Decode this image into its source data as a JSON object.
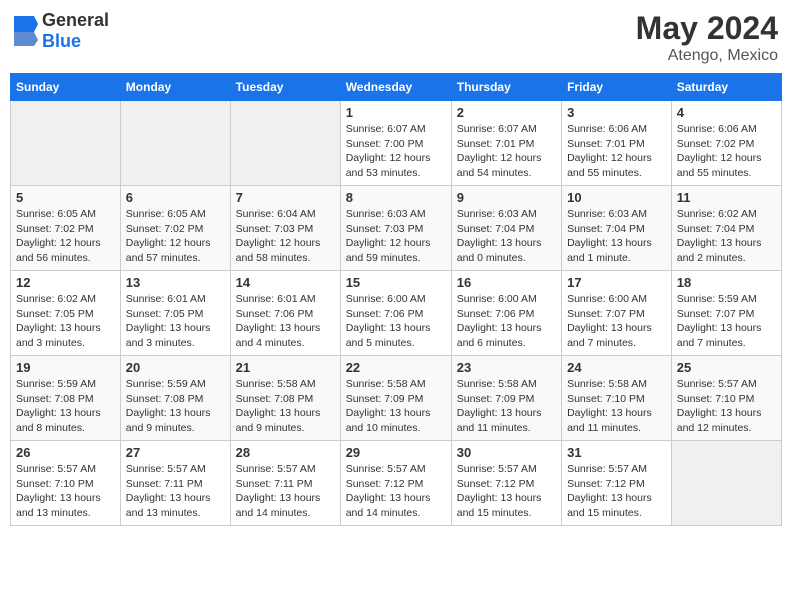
{
  "header": {
    "logo": {
      "general": "General",
      "blue": "Blue"
    },
    "title": "May 2024",
    "location": "Atengo, Mexico"
  },
  "calendar": {
    "days_of_week": [
      "Sunday",
      "Monday",
      "Tuesday",
      "Wednesday",
      "Thursday",
      "Friday",
      "Saturday"
    ],
    "weeks": [
      [
        {
          "day": "",
          "info": ""
        },
        {
          "day": "",
          "info": ""
        },
        {
          "day": "",
          "info": ""
        },
        {
          "day": "1",
          "info": "Sunrise: 6:07 AM\nSunset: 7:00 PM\nDaylight: 12 hours\nand 53 minutes."
        },
        {
          "day": "2",
          "info": "Sunrise: 6:07 AM\nSunset: 7:01 PM\nDaylight: 12 hours\nand 54 minutes."
        },
        {
          "day": "3",
          "info": "Sunrise: 6:06 AM\nSunset: 7:01 PM\nDaylight: 12 hours\nand 55 minutes."
        },
        {
          "day": "4",
          "info": "Sunrise: 6:06 AM\nSunset: 7:02 PM\nDaylight: 12 hours\nand 55 minutes."
        }
      ],
      [
        {
          "day": "5",
          "info": "Sunrise: 6:05 AM\nSunset: 7:02 PM\nDaylight: 12 hours\nand 56 minutes."
        },
        {
          "day": "6",
          "info": "Sunrise: 6:05 AM\nSunset: 7:02 PM\nDaylight: 12 hours\nand 57 minutes."
        },
        {
          "day": "7",
          "info": "Sunrise: 6:04 AM\nSunset: 7:03 PM\nDaylight: 12 hours\nand 58 minutes."
        },
        {
          "day": "8",
          "info": "Sunrise: 6:03 AM\nSunset: 7:03 PM\nDaylight: 12 hours\nand 59 minutes."
        },
        {
          "day": "9",
          "info": "Sunrise: 6:03 AM\nSunset: 7:04 PM\nDaylight: 13 hours\nand 0 minutes."
        },
        {
          "day": "10",
          "info": "Sunrise: 6:03 AM\nSunset: 7:04 PM\nDaylight: 13 hours\nand 1 minute."
        },
        {
          "day": "11",
          "info": "Sunrise: 6:02 AM\nSunset: 7:04 PM\nDaylight: 13 hours\nand 2 minutes."
        }
      ],
      [
        {
          "day": "12",
          "info": "Sunrise: 6:02 AM\nSunset: 7:05 PM\nDaylight: 13 hours\nand 3 minutes."
        },
        {
          "day": "13",
          "info": "Sunrise: 6:01 AM\nSunset: 7:05 PM\nDaylight: 13 hours\nand 3 minutes."
        },
        {
          "day": "14",
          "info": "Sunrise: 6:01 AM\nSunset: 7:06 PM\nDaylight: 13 hours\nand 4 minutes."
        },
        {
          "day": "15",
          "info": "Sunrise: 6:00 AM\nSunset: 7:06 PM\nDaylight: 13 hours\nand 5 minutes."
        },
        {
          "day": "16",
          "info": "Sunrise: 6:00 AM\nSunset: 7:06 PM\nDaylight: 13 hours\nand 6 minutes."
        },
        {
          "day": "17",
          "info": "Sunrise: 6:00 AM\nSunset: 7:07 PM\nDaylight: 13 hours\nand 7 minutes."
        },
        {
          "day": "18",
          "info": "Sunrise: 5:59 AM\nSunset: 7:07 PM\nDaylight: 13 hours\nand 7 minutes."
        }
      ],
      [
        {
          "day": "19",
          "info": "Sunrise: 5:59 AM\nSunset: 7:08 PM\nDaylight: 13 hours\nand 8 minutes."
        },
        {
          "day": "20",
          "info": "Sunrise: 5:59 AM\nSunset: 7:08 PM\nDaylight: 13 hours\nand 9 minutes."
        },
        {
          "day": "21",
          "info": "Sunrise: 5:58 AM\nSunset: 7:08 PM\nDaylight: 13 hours\nand 9 minutes."
        },
        {
          "day": "22",
          "info": "Sunrise: 5:58 AM\nSunset: 7:09 PM\nDaylight: 13 hours\nand 10 minutes."
        },
        {
          "day": "23",
          "info": "Sunrise: 5:58 AM\nSunset: 7:09 PM\nDaylight: 13 hours\nand 11 minutes."
        },
        {
          "day": "24",
          "info": "Sunrise: 5:58 AM\nSunset: 7:10 PM\nDaylight: 13 hours\nand 11 minutes."
        },
        {
          "day": "25",
          "info": "Sunrise: 5:57 AM\nSunset: 7:10 PM\nDaylight: 13 hours\nand 12 minutes."
        }
      ],
      [
        {
          "day": "26",
          "info": "Sunrise: 5:57 AM\nSunset: 7:10 PM\nDaylight: 13 hours\nand 13 minutes."
        },
        {
          "day": "27",
          "info": "Sunrise: 5:57 AM\nSunset: 7:11 PM\nDaylight: 13 hours\nand 13 minutes."
        },
        {
          "day": "28",
          "info": "Sunrise: 5:57 AM\nSunset: 7:11 PM\nDaylight: 13 hours\nand 14 minutes."
        },
        {
          "day": "29",
          "info": "Sunrise: 5:57 AM\nSunset: 7:12 PM\nDaylight: 13 hours\nand 14 minutes."
        },
        {
          "day": "30",
          "info": "Sunrise: 5:57 AM\nSunset: 7:12 PM\nDaylight: 13 hours\nand 15 minutes."
        },
        {
          "day": "31",
          "info": "Sunrise: 5:57 AM\nSunset: 7:12 PM\nDaylight: 13 hours\nand 15 minutes."
        },
        {
          "day": "",
          "info": ""
        }
      ]
    ]
  }
}
